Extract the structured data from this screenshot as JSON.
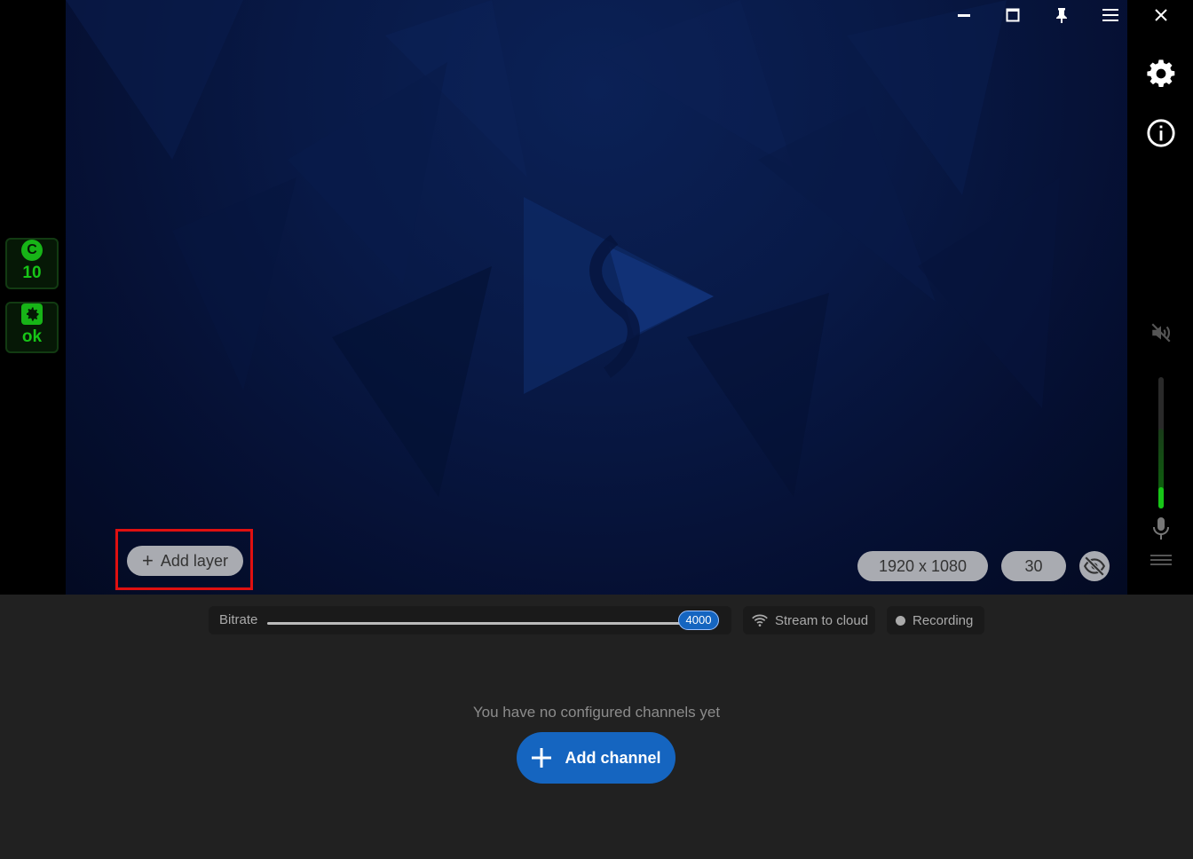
{
  "status_badges": [
    {
      "icon": "C",
      "value": "10"
    },
    {
      "icon": "gear",
      "value": "ok"
    }
  ],
  "preview": {
    "add_layer_label": "Add layer",
    "resolution": "1920 x 1080",
    "fps": "30"
  },
  "controls": {
    "bitrate_label": "Bitrate",
    "bitrate_value": "4000",
    "stream_label": "Stream to cloud",
    "recording_label": "Recording"
  },
  "channels": {
    "empty_message": "You have no configured channels yet",
    "add_channel_label": "Add channel"
  },
  "colors": {
    "accent": "#1565c0",
    "status_green": "#17c617",
    "highlight_red": "#e01010"
  }
}
